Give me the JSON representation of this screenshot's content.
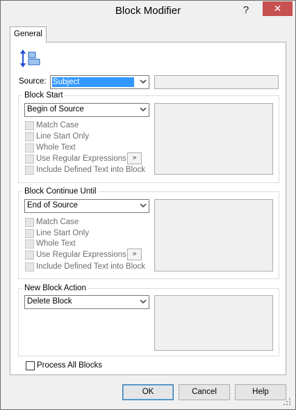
{
  "window": {
    "title": "Block Modifier",
    "help_glyph": "?",
    "close_glyph": "✕"
  },
  "tabs": [
    {
      "label": "General"
    }
  ],
  "source": {
    "label": "Source:",
    "selected": "Subject",
    "extra_value": ""
  },
  "block_start": {
    "title": "Block Start",
    "selected": "Begin of Source",
    "options": [
      {
        "label": "Match Case"
      },
      {
        "label": "Line Start Only"
      },
      {
        "label": "Whole Text"
      },
      {
        "label": "Use Regular Expressions"
      },
      {
        "label": "Include Defined Text into Block"
      }
    ],
    "more_glyph": "»"
  },
  "block_continue": {
    "title": "Block Continue Until",
    "selected": "End of Source",
    "options": [
      {
        "label": "Match Case"
      },
      {
        "label": "Line Start Only"
      },
      {
        "label": "Whole Text"
      },
      {
        "label": "Use Regular Expressions"
      },
      {
        "label": "Include Defined Text into Block"
      }
    ],
    "more_glyph": "»"
  },
  "new_block_action": {
    "title": "New Block Action",
    "selected": "Delete Block"
  },
  "process_all": {
    "label": "Process All Blocks",
    "checked": false
  },
  "buttons": {
    "ok": "OK",
    "cancel": "Cancel",
    "help": "Help"
  },
  "colors": {
    "selection": "#3399ff",
    "close_button": "#c75050",
    "default_button_border": "#3c7fb1"
  }
}
